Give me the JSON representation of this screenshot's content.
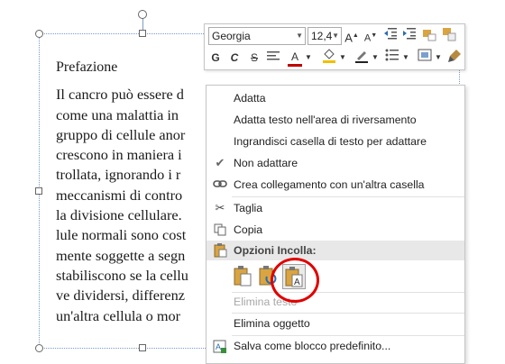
{
  "document": {
    "title": "Prefazione",
    "lines": [
      "Il cancro può essere d",
      "come una malattia in ",
      "gruppo di cellule anor",
      "crescono in maniera i",
      "trollata, ignorando i r",
      "meccanismi di contro",
      "la divisione cellulare.",
      "lule normali sono cost",
      "mente soggette a segn",
      "stabiliscono se la cellu",
      "ve dividersi, differenz",
      "un'altra cellula o mor"
    ]
  },
  "toolbar": {
    "font_name": "Georgia",
    "font_size": "12,4",
    "grow_font": "A",
    "shrink_font": "A",
    "bold": "G",
    "italic": "C",
    "strike": "S",
    "font_color": "A"
  },
  "menu": {
    "items": [
      {
        "label": "Adatta",
        "icon": "none",
        "disabled": false
      },
      {
        "label": "Adatta testo nell'area di riversamento",
        "icon": "none",
        "disabled": false
      },
      {
        "label": "Ingrandisci casella di testo per adattare",
        "icon": "none",
        "disabled": false
      },
      {
        "label": "Non adattare",
        "icon": "check-icon",
        "disabled": false
      },
      {
        "label": "Crea collegamento con un'altra casella",
        "icon": "link-icon",
        "disabled": false
      },
      {
        "label": "Taglia",
        "icon": "scissors-icon",
        "disabled": false
      },
      {
        "label": "Copia",
        "icon": "copy-icon",
        "disabled": false
      },
      {
        "label": "Elimina testo",
        "icon": "none",
        "disabled": true
      },
      {
        "label": "Elimina oggetto",
        "icon": "none",
        "disabled": false
      },
      {
        "label": "Salva come blocco predefinito...",
        "icon": "save-block-icon",
        "disabled": false
      }
    ],
    "paste_header": "Opzioni Incolla:",
    "paste_options": [
      "paste-keep-formatting-icon",
      "paste-merge-formatting-icon",
      "paste-text-only-icon"
    ]
  },
  "colors": {
    "highlight_circle": "#e00000",
    "font_color_underline": "#c00000",
    "selection_border": "#7a9cc6"
  }
}
